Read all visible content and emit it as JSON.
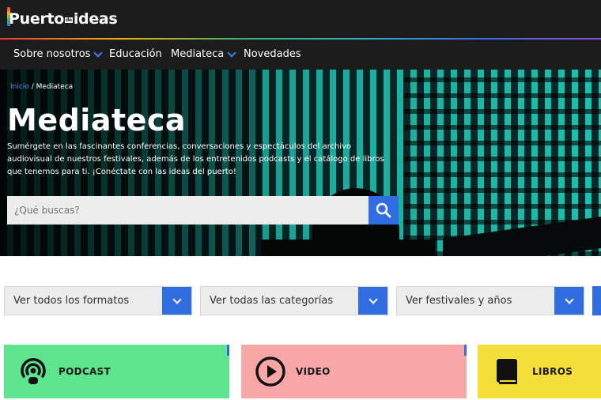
{
  "header": {
    "logo_part1": "Puerto",
    "logo_part2": "de",
    "logo_part3": "ideas"
  },
  "nav": {
    "items": [
      {
        "label": "Sobre nosotros",
        "has_dropdown": true
      },
      {
        "label": "Educación",
        "has_dropdown": false
      },
      {
        "label": "Mediateca",
        "has_dropdown": true
      },
      {
        "label": "Novedades",
        "has_dropdown": false
      }
    ]
  },
  "breadcrumb": {
    "home": "Inicio",
    "separator": "/",
    "current": "Mediateca"
  },
  "hero": {
    "title": "Mediateca",
    "description": "Sumérgete en las fascinantes conferencias, conversaciones y espectáculos del archivo audiovisual de nuestros festivales, además de los entretenidos podcasts y el catálogo de libros que tenemos para ti. ¡Conéctate con las ideas del puerto!"
  },
  "search": {
    "placeholder": "¿Qué buscas?",
    "icon": "search-icon"
  },
  "filters": [
    {
      "label": "Ver todos los formatos"
    },
    {
      "label": "Ver todas las categorías"
    },
    {
      "label": "Ver festivales y años"
    }
  ],
  "categories": [
    {
      "label": "PODCAST",
      "icon": "podcast-icon",
      "color": "#5ee48f"
    },
    {
      "label": "VIDEO",
      "icon": "play-icon",
      "color": "#f9a6a6"
    },
    {
      "label": "LIBROS",
      "icon": "book-icon",
      "color": "#f7df3a"
    }
  ],
  "colors": {
    "accent": "#2f6de0",
    "nav_bg": "#1c1c1c",
    "link": "#4d8ef5"
  }
}
